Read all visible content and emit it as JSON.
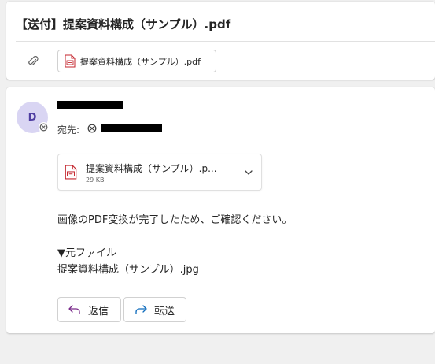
{
  "header": {
    "subject": "【送付】提案資料構成（サンプル）.pdf",
    "attachment_chip": {
      "name": "提案資料構成（サンプル）.pdf",
      "icon": "pdf-file-icon"
    }
  },
  "message": {
    "sender_initial": "D",
    "to_label": "宛先:",
    "attachment": {
      "name": "提案資料構成（サンプル）.p...",
      "size": "29 KB",
      "icon": "pdf-file-icon"
    },
    "body_lines": [
      "画像のPDF変換が完了したため、ご確認ください。",
      "▼元ファイル",
      "提案資料構成（サンプル）.jpg"
    ],
    "actions": {
      "reply_label": "返信",
      "forward_label": "転送"
    }
  },
  "colors": {
    "avatar_bg": "#d9d5f3",
    "avatar_text": "#4f3ea2",
    "pdf_red": "#c4262e",
    "reply_icon": "#7a2b8a",
    "forward_icon": "#0f6cbd"
  }
}
